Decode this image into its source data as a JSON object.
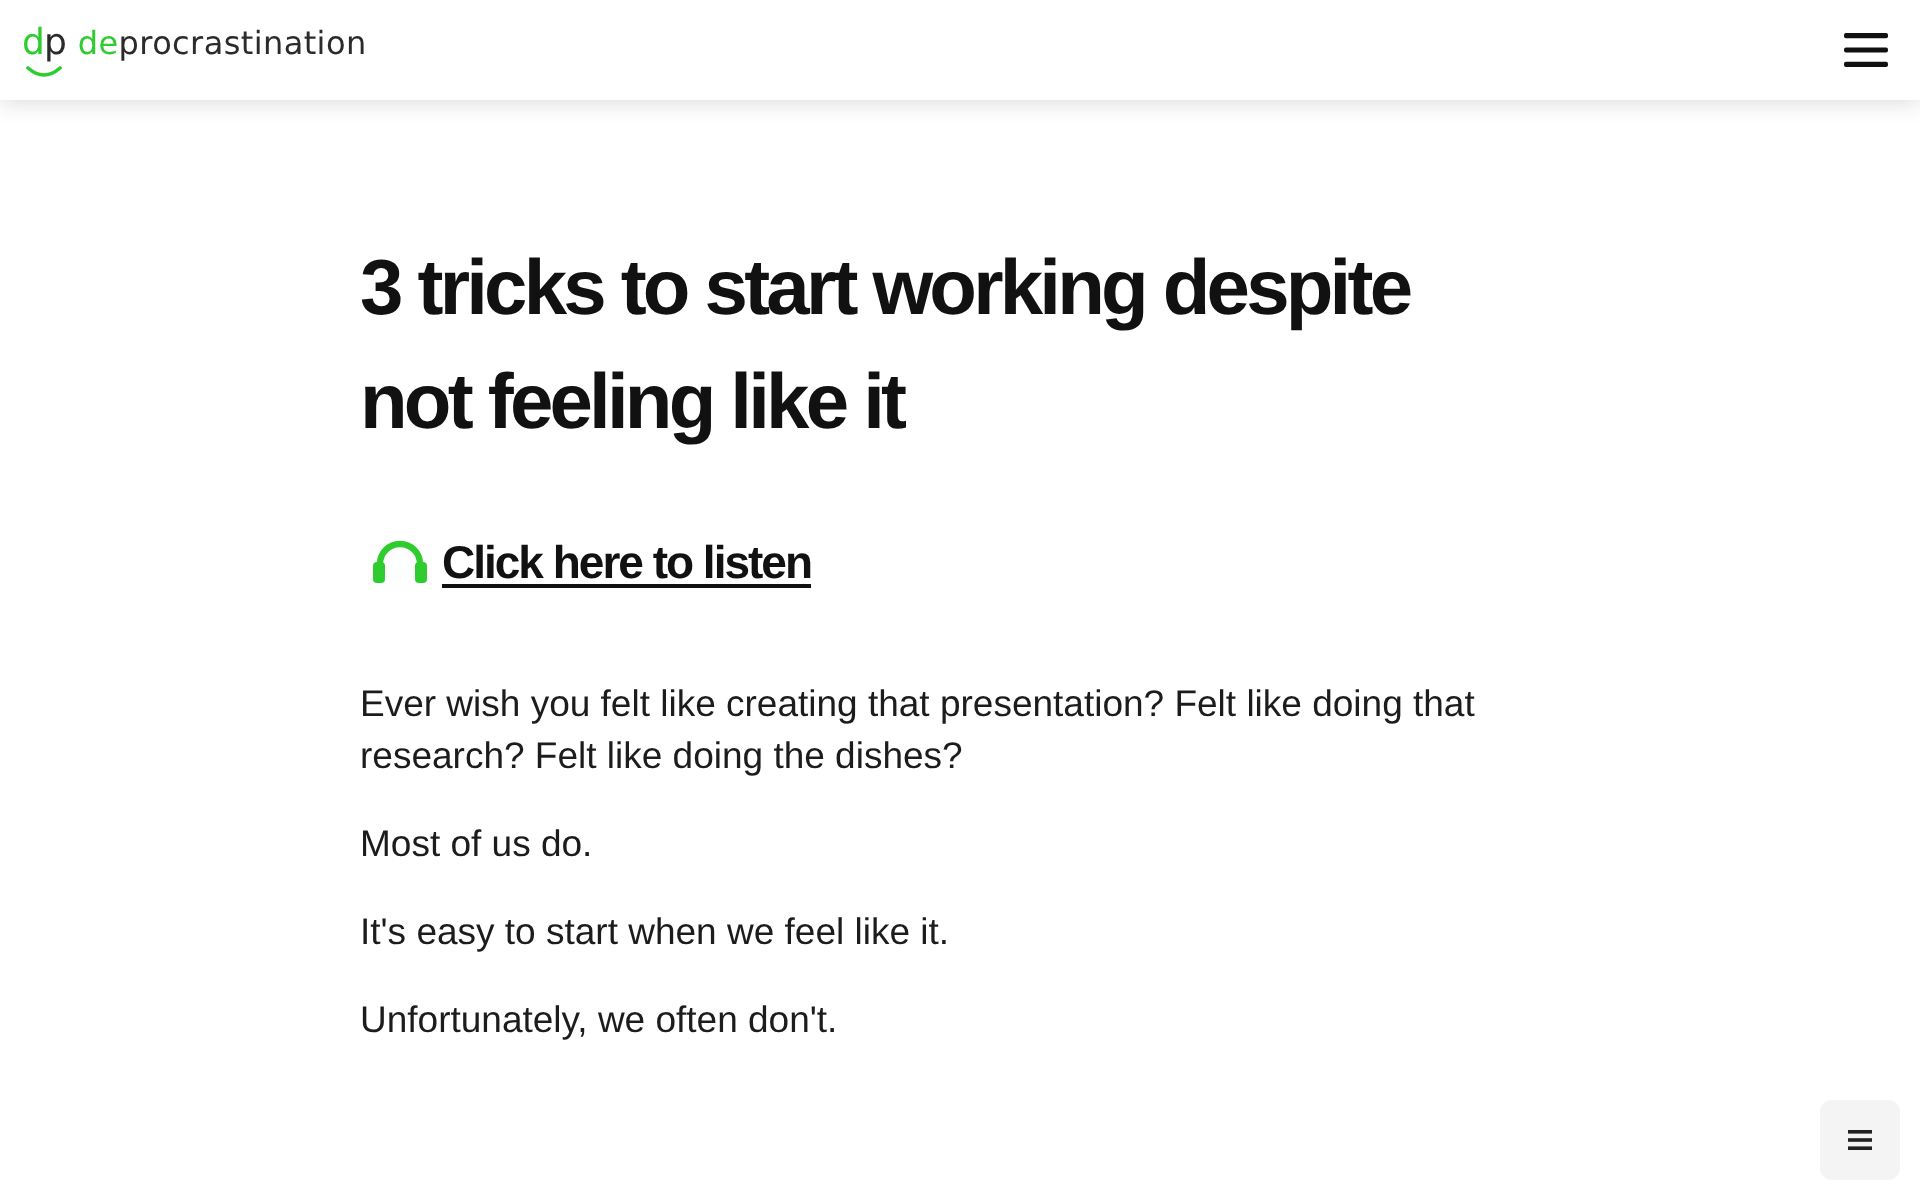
{
  "header": {
    "logo": {
      "mark": [
        {
          "text": "d",
          "accent": true
        },
        {
          "text": "p",
          "accent": false
        }
      ],
      "name": [
        {
          "text": "de",
          "accent": true
        },
        {
          "text": "procrastination",
          "accent": false
        }
      ]
    }
  },
  "article": {
    "title": "3 tricks to start working despite not feeling like it",
    "listen_link": "Click here to listen",
    "paragraphs": [
      "Ever wish you felt like creating that presentation? Felt like doing that research? Felt like doing the dishes?",
      "Most of us do.",
      "It's easy to start when we feel like it.",
      "Unfortunately, we often don't."
    ]
  }
}
